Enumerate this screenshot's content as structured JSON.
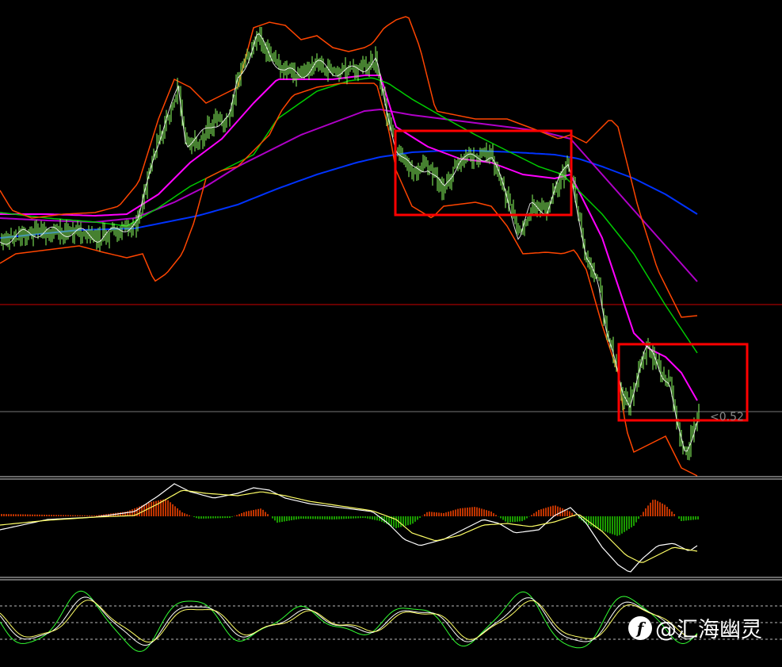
{
  "chart_data": [
    {
      "type": "candlestick",
      "panel": "price",
      "series": [
        {
          "name": "",
          "color": "#0033ff",
          "kind": "ma_slow"
        },
        {
          "name": "",
          "color": "#b000c8",
          "kind": "ma_mid"
        },
        {
          "name": "",
          "color": "#ff00ff",
          "kind": "ma_fast"
        },
        {
          "name": "",
          "color": "#00cc00",
          "kind": "ma_green"
        },
        {
          "name": "",
          "color": "#ff4500",
          "kind": "bollinger_bands"
        }
      ],
      "candle_color": "#8cff60",
      "horizontal_line_color": "#cc0000",
      "current_line_color": "#777777",
      "highlight_color": "#ff0000",
      "highlight_count": 2,
      "price_label": "<0.52"
    },
    {
      "type": "macd",
      "panel": "macd",
      "positive_color": "#ff4500",
      "negative_color": "#22cc00",
      "line_colors": [
        "#ffffff",
        "#ffff66"
      ]
    },
    {
      "type": "line",
      "panel": "stochastic",
      "line_colors": [
        "#33ff33",
        "#ffffff",
        "#ffff66"
      ],
      "grid": "dashed"
    }
  ],
  "watermark": {
    "logo": "f",
    "text": "@汇海幽灵"
  }
}
